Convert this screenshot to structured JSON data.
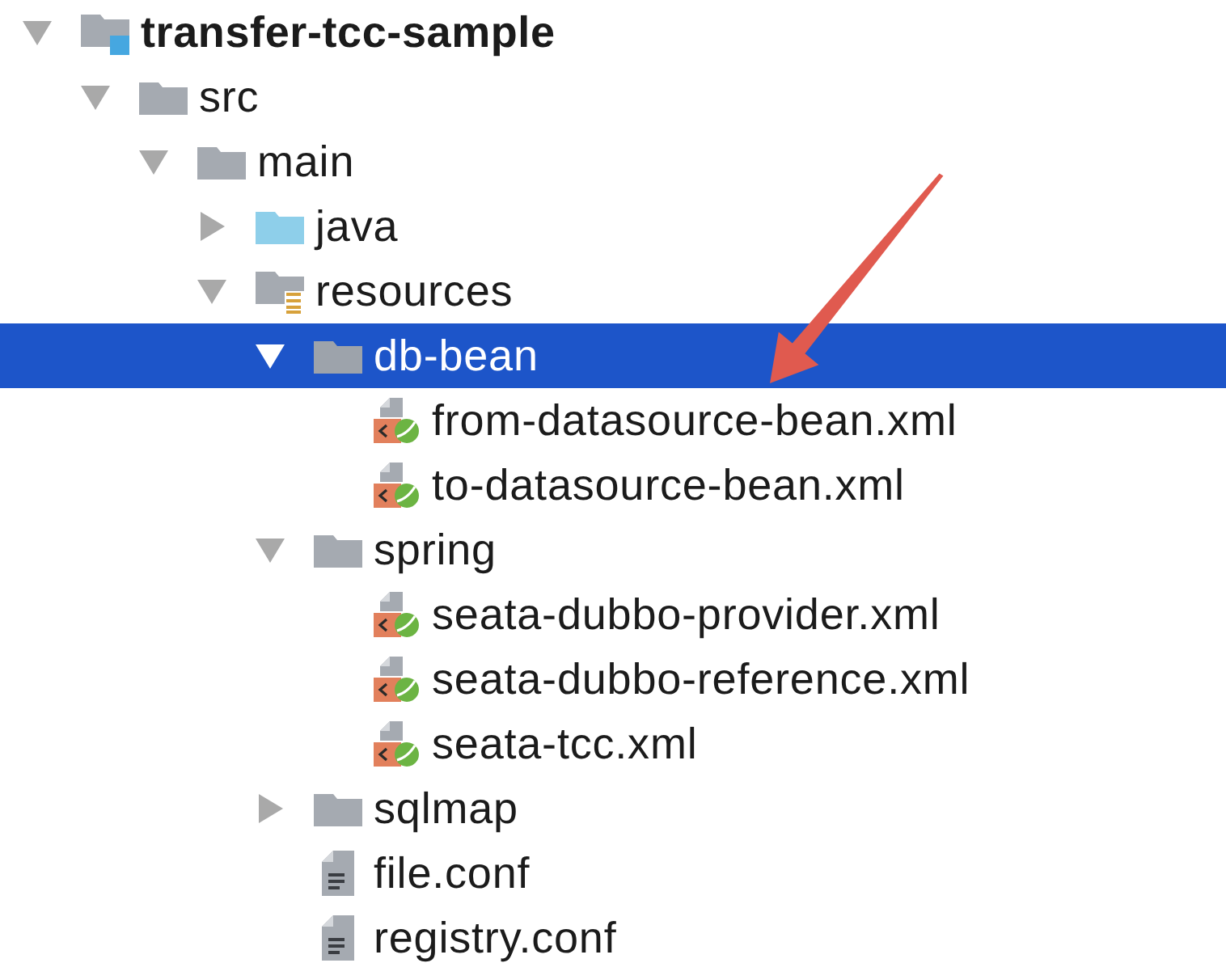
{
  "tree": {
    "items": [
      {
        "label": "transfer-tcc-sample",
        "kind": "module",
        "expanded": true,
        "selected": false,
        "children": [
          {
            "label": "src",
            "kind": "folder",
            "expanded": true,
            "selected": false,
            "children": [
              {
                "label": "main",
                "kind": "folder",
                "expanded": true,
                "selected": false,
                "children": [
                  {
                    "label": "java",
                    "kind": "source_folder",
                    "expanded": false,
                    "selected": false
                  },
                  {
                    "label": "resources",
                    "kind": "resource_folder",
                    "expanded": true,
                    "selected": false,
                    "children": [
                      {
                        "label": "db-bean",
                        "kind": "folder",
                        "expanded": true,
                        "selected": true,
                        "children": [
                          {
                            "label": "from-datasource-bean.xml",
                            "kind": "spring_xml",
                            "selected": false
                          },
                          {
                            "label": "to-datasource-bean.xml",
                            "kind": "spring_xml",
                            "selected": false
                          }
                        ]
                      },
                      {
                        "label": "spring",
                        "kind": "folder",
                        "expanded": true,
                        "selected": false,
                        "children": [
                          {
                            "label": "seata-dubbo-provider.xml",
                            "kind": "spring_xml",
                            "selected": false
                          },
                          {
                            "label": "seata-dubbo-reference.xml",
                            "kind": "spring_xml",
                            "selected": false
                          },
                          {
                            "label": "seata-tcc.xml",
                            "kind": "spring_xml",
                            "selected": false
                          }
                        ]
                      },
                      {
                        "label": "sqlmap",
                        "kind": "folder",
                        "expanded": false,
                        "selected": false
                      },
                      {
                        "label": "file.conf",
                        "kind": "text_file",
                        "selected": false
                      },
                      {
                        "label": "registry.conf",
                        "kind": "text_file",
                        "selected": false
                      }
                    ]
                  }
                ]
              }
            ]
          }
        ]
      }
    ]
  }
}
